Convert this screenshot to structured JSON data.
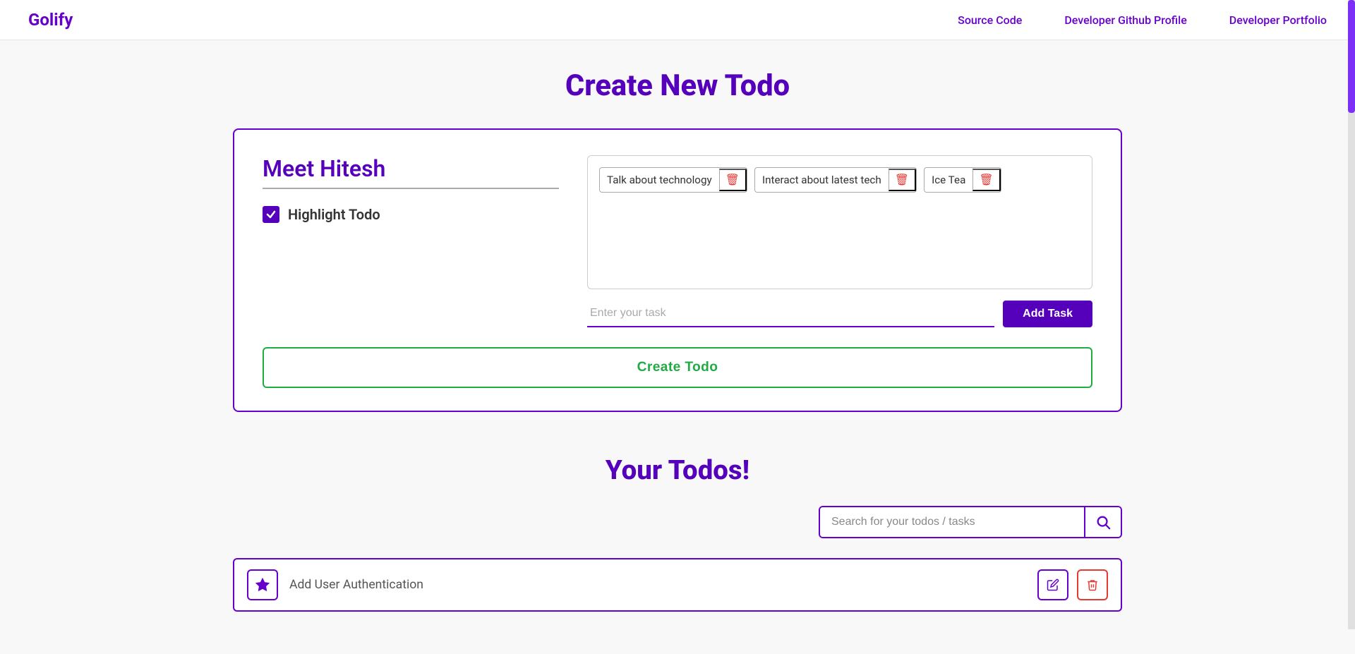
{
  "navbar": {
    "brand": "Golify",
    "links": [
      {
        "label": "Source Code",
        "id": "source-code"
      },
      {
        "label": "Developer Github Profile",
        "id": "dev-github"
      },
      {
        "label": "Developer Portfolio",
        "id": "dev-portfolio"
      }
    ]
  },
  "create_todo": {
    "title": "Create New Todo",
    "user_name": "Meet Hitesh",
    "highlight_todo_label": "Highlight Todo",
    "highlight_checked": true,
    "tasks": [
      {
        "id": "task-1",
        "label": "Talk about technology"
      },
      {
        "id": "task-2",
        "label": "Interact about latest tech"
      },
      {
        "id": "task-3",
        "label": "Ice Tea"
      }
    ],
    "task_input_placeholder": "Enter your task",
    "add_task_btn_label": "Add Task",
    "create_todo_btn_label": "Create Todo"
  },
  "todos_section": {
    "title": "Your Todos!",
    "search_placeholder": "Search for your todos / tasks",
    "items": [
      {
        "id": "todo-1",
        "name": "Add User Authentication"
      }
    ]
  }
}
